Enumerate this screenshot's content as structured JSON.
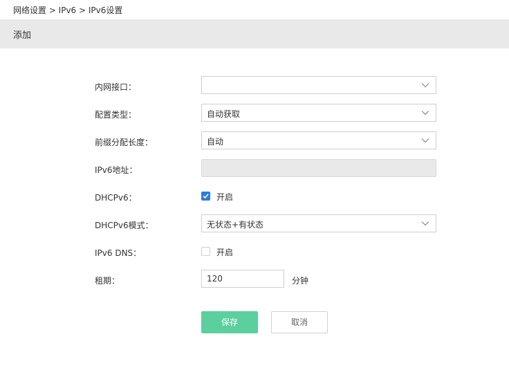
{
  "breadcrumb": "网络设置 > IPv6 > IPv6设置",
  "header": {
    "title": "添加"
  },
  "form": {
    "lan_interface": {
      "label": "内网接口：",
      "value": "",
      "icon": "chevron-down-icon"
    },
    "config_type": {
      "label": "配置类型：",
      "value": "自动获取",
      "icon": "chevron-down-icon"
    },
    "prefix_length": {
      "label": "前缀分配长度：",
      "value": "自动",
      "icon": "chevron-down-icon"
    },
    "ipv6_address": {
      "label": "IPv6地址：",
      "value": ""
    },
    "dhcpv6": {
      "label": "DHCPv6：",
      "checkbox_label": "开启",
      "checked": true
    },
    "dhcpv6_mode": {
      "label": "DHCPv6模式：",
      "value": "无状态+有状态",
      "icon": "chevron-down-icon"
    },
    "ipv6_dns": {
      "label": "IPv6 DNS：",
      "checkbox_label": "开启",
      "checked": false
    },
    "lease": {
      "label": "租期：",
      "value": "120",
      "unit": "分钟"
    }
  },
  "buttons": {
    "save": "保存",
    "cancel": "取消"
  },
  "colors": {
    "save_button": "#5ccf9f",
    "checkbox_checked": "#2c7be5",
    "header_bg": "#e9e9e9"
  }
}
